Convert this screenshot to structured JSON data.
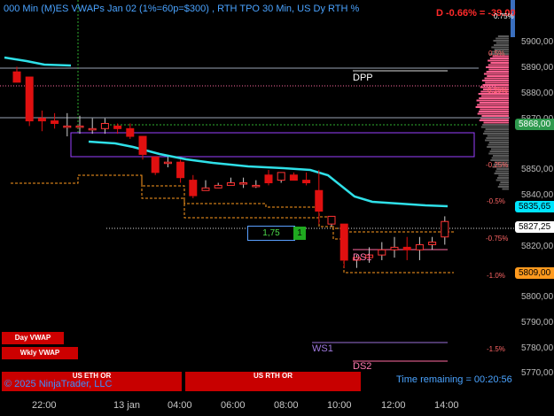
{
  "header": {
    "title": "000 Min (M)ES VWAPs Jan 02 (1%=60p=$300) , RTH TPO 30 Min, US Dy RTH %",
    "delta": "D -0.66% = -39.00",
    "top_right_pct": "0.75%"
  },
  "price_axis": {
    "ticks": [
      "5900,00",
      "5890,00",
      "5880,00",
      "5870,00",
      "5850,00",
      "5840,00",
      "5820,00",
      "5800,00",
      "5790,00",
      "5780,00",
      "5770,00"
    ],
    "markers": [
      {
        "label": "5868,00",
        "color": "#2e9a4e"
      },
      {
        "label": "5835,65",
        "color": "#00e5ff"
      },
      {
        "label": "5827,25",
        "color": "#ffffff"
      },
      {
        "label": "5809,00",
        "color": "#ff9a1e"
      }
    ]
  },
  "time_axis": {
    "ticks": [
      "22:00",
      "13 jan",
      "04:00",
      "06:00",
      "08:00",
      "10:00",
      "12:00",
      "14:00"
    ]
  },
  "percent_labels": [
    "0.5%",
    "0.25%",
    "-0.25%",
    "-0.5%",
    "-0.75%",
    "-1.0%",
    "-1.5%"
  ],
  "levels": {
    "dpp": "DPP",
    "ds1": "DS1",
    "ws1": "WS1",
    "ds2": "DS2"
  },
  "position": {
    "price": "1,75",
    "quantity": "1"
  },
  "buttons": {
    "day_vwap": "Day VWAP",
    "wkly_vwap": "Wkly VWAP"
  },
  "sessions": {
    "eth": "US ETH OR",
    "rth": "US RTH OR"
  },
  "footer": {
    "copyright": "© 2025 NinjaTrader, LLC",
    "time_remaining": "Time remaining = 00:20:56"
  },
  "colors": {
    "vwap": "#2fe0e8",
    "bull": "#ffffff",
    "bear": "#e01010",
    "value_area": "#ff6090",
    "box": "#9a40ff"
  },
  "chart_data": {
    "type": "candlestick",
    "price_range": [
      5765,
      5905
    ],
    "candles": [
      {
        "o": 5884,
        "h": 5886,
        "l": 5880,
        "c": 5880
      },
      {
        "o": 5882,
        "h": 5882,
        "l": 5863,
        "c": 5865
      },
      {
        "o": 5866,
        "h": 5869,
        "l": 5861,
        "c": 5865
      },
      {
        "o": 5865,
        "h": 5868,
        "l": 5862,
        "c": 5864
      },
      {
        "o": 5863,
        "h": 5868,
        "l": 5859,
        "c": 5863
      },
      {
        "o": 5863,
        "h": 5867,
        "l": 5860,
        "c": 5863
      },
      {
        "o": 5862,
        "h": 5866,
        "l": 5860,
        "c": 5862
      },
      {
        "o": 5862,
        "h": 5866,
        "l": 5860,
        "c": 5864
      },
      {
        "o": 5863,
        "h": 5864,
        "l": 5860,
        "c": 5862
      },
      {
        "o": 5862,
        "h": 5864,
        "l": 5858,
        "c": 5859
      },
      {
        "o": 5859,
        "h": 5859,
        "l": 5850,
        "c": 5852
      },
      {
        "o": 5851,
        "h": 5851,
        "l": 5844,
        "c": 5845
      },
      {
        "o": 5849,
        "h": 5851,
        "l": 5847,
        "c": 5849
      },
      {
        "o": 5849,
        "h": 5850,
        "l": 5841,
        "c": 5843
      },
      {
        "o": 5842,
        "h": 5844,
        "l": 5835,
        "c": 5836
      },
      {
        "o": 5838,
        "h": 5842,
        "l": 5838,
        "c": 5839
      },
      {
        "o": 5839,
        "h": 5841,
        "l": 5839,
        "c": 5840
      },
      {
        "o": 5840,
        "h": 5843,
        "l": 5840,
        "c": 5841
      },
      {
        "o": 5841,
        "h": 5843,
        "l": 5839,
        "c": 5841
      },
      {
        "o": 5840,
        "h": 5842,
        "l": 5839,
        "c": 5840
      },
      {
        "o": 5844,
        "h": 5846,
        "l": 5840,
        "c": 5841
      },
      {
        "o": 5842,
        "h": 5845,
        "l": 5841,
        "c": 5845
      },
      {
        "o": 5844,
        "h": 5845,
        "l": 5842,
        "c": 5842
      },
      {
        "o": 5842,
        "h": 5845,
        "l": 5840,
        "c": 5841
      },
      {
        "o": 5838,
        "h": 5846,
        "l": 5825,
        "c": 5830
      },
      {
        "o": 5825,
        "h": 5828,
        "l": 5824,
        "c": 5828
      },
      {
        "o": 5825,
        "h": 5825,
        "l": 5808,
        "c": 5811
      },
      {
        "o": 5811,
        "h": 5813,
        "l": 5808,
        "c": 5812
      },
      {
        "o": 5812,
        "h": 5816,
        "l": 5810,
        "c": 5813
      },
      {
        "o": 5813,
        "h": 5818,
        "l": 5811,
        "c": 5815
      },
      {
        "o": 5815,
        "h": 5820,
        "l": 5812,
        "c": 5816
      },
      {
        "o": 5816,
        "h": 5820,
        "l": 5811,
        "c": 5815
      },
      {
        "o": 5815,
        "h": 5820,
        "l": 5811,
        "c": 5817
      },
      {
        "o": 5817,
        "h": 5820,
        "l": 5815,
        "c": 5818
      },
      {
        "o": 5820,
        "h": 5828,
        "l": 5817,
        "c": 5826
      }
    ]
  }
}
